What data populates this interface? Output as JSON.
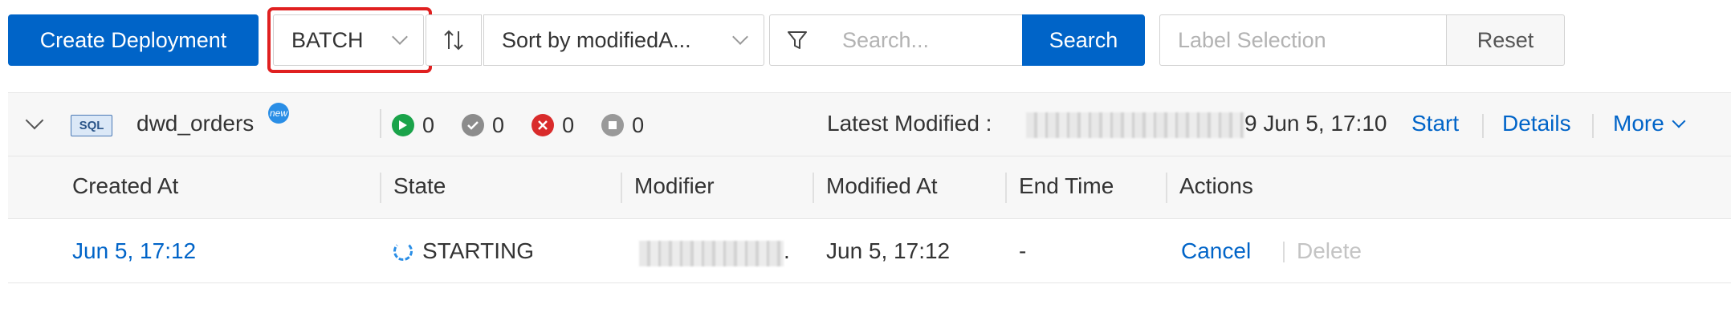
{
  "toolbar": {
    "create_label": "Create Deployment",
    "type_select_value": "BATCH",
    "sort_select_value": "Sort by modifiedA...",
    "search_placeholder": "Search...",
    "search_label": "Search",
    "label_placeholder": "Label Selection",
    "reset_label": "Reset"
  },
  "group": {
    "type_badge": "SQL",
    "name": "dwd_orders",
    "new_badge": "new",
    "status_counts": {
      "running": "0",
      "finished": "0",
      "failed": "0",
      "stopped": "0"
    },
    "latest_modified_label": "Latest Modified :",
    "latest_modified_value": "9 Jun 5, 17:10",
    "start_label": "Start",
    "details_label": "Details",
    "more_label": "More"
  },
  "table": {
    "columns": [
      "Created At",
      "State",
      "Modifier",
      "Modified At",
      "End Time",
      "Actions"
    ],
    "rows": [
      {
        "created_at": "Jun 5, 17:12",
        "state": "STARTING",
        "modifier_suffix": ".",
        "modified_at": "Jun 5, 17:12",
        "end_time": "-",
        "action_cancel": "Cancel",
        "action_delete": "Delete"
      }
    ]
  },
  "colors": {
    "primary": "#0064c8",
    "highlight": "#e02020",
    "running": "#1aa34a",
    "failed": "#d92b2b"
  }
}
